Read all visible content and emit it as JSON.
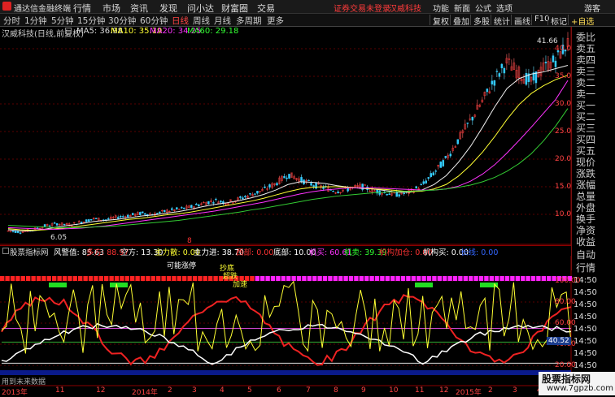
{
  "app": {
    "name": "通达信金融终端"
  },
  "menu": {
    "items": [
      "行情",
      "市场",
      "资讯",
      "发现",
      "问小达",
      "财富圈",
      "交易"
    ],
    "warning": "证券交易未登录",
    "stock": "汉威科技",
    "right_items": [
      "功能",
      "新面",
      "公式",
      "选项"
    ],
    "guest": "游客"
  },
  "toolbar": {
    "periods": [
      "分时",
      "1分钟",
      "5分钟",
      "15分钟",
      "30分钟",
      "60分钟",
      "日线",
      "周线",
      "月线",
      "多周期",
      "更多"
    ],
    "active_period": "日线",
    "right_buttons": [
      "复权",
      "叠加",
      "多股",
      "统计",
      "画线",
      "F10",
      "标记",
      "+自选"
    ]
  },
  "info": {
    "title": "汉威科技(日线,前复权)",
    "ma5": "MA5: 36.98",
    "ma10": "MA10: 35.19",
    "ma20": "MA20: 34.25",
    "ma60": "MA60: 29.18",
    "high_label": "41.66",
    "low_label": "6.05",
    "marker": "8"
  },
  "right_panel": {
    "items": [
      "委比",
      "卖五",
      "卖四",
      "卖三",
      "卖二",
      "卖一",
      "买一",
      "买二",
      "买三",
      "买四",
      "买五",
      "现价",
      "涨跌",
      "涨幅",
      "总量",
      "外盘",
      "换手",
      "净资",
      "收益",
      "自动",
      "行情"
    ]
  },
  "price_axis": {
    "ticks": [
      "40.00",
      "35.00",
      "30.00",
      "25.00",
      "20.00",
      "15.00",
      "10.00"
    ]
  },
  "indicator": {
    "name": "股票指标网",
    "items": [
      {
        "label": "风警值: 85.63",
        "color": "#ffffff"
      },
      {
        "label": "多方: 88.97",
        "color": "#ff3333"
      },
      {
        "label": "空方: 13.30",
        "color": "#ffffff"
      },
      {
        "label": "主力散: 0.00",
        "color": "#ffff33"
      },
      {
        "label": "主力进: 38.70",
        "color": "#ffffff"
      },
      {
        "label": "西部: 0.00",
        "color": "#ff3333"
      },
      {
        "label": "底部: 10.00",
        "color": "#ffffff"
      },
      {
        "label": "机买: 60.61",
        "color": "#ff33ff"
      },
      {
        "label": "机卖: 39.39",
        "color": "#33ff33"
      },
      {
        "label": "机构加仓: 0.00",
        "color": "#ff3333"
      },
      {
        "label": "机构买: 0.00",
        "color": "#ffffff"
      },
      {
        "label": "长线: 0.00",
        "color": "#3366ff"
      }
    ],
    "axis_ticks": [
      "100.00",
      "80.00",
      "60.00",
      "40.00",
      "20.00"
    ],
    "value_badge": "40.52",
    "annotations": [
      "可能涨停",
      "抄底",
      "超跌",
      "加速"
    ],
    "footer_text": "用到未来数据"
  },
  "time_axis": {
    "labels": [
      "2013年",
      "11",
      "12",
      "2014年",
      "2",
      "3",
      "4",
      "5",
      "6",
      "7",
      "8",
      "9",
      "10",
      "11",
      "12",
      "2015年",
      "2",
      "3",
      "4"
    ]
  },
  "right_times": [
    "14:50",
    "14:50",
    "14:50",
    "14:50",
    "14:50",
    "14:50",
    "14:50",
    "14:50"
  ],
  "watermark": {
    "title": "股票指标网",
    "url": "www.7gpzb.com"
  },
  "chart_data": {
    "type": "candlestick",
    "title": "汉威科技(日线,前复权)",
    "ylim": [
      4,
      44
    ],
    "y_ticks": [
      10,
      15,
      20,
      25,
      30,
      35,
      40
    ],
    "series": [
      {
        "name": "close",
        "values": [
          7.0,
          6.8,
          7.2,
          7.9,
          8.3,
          8.1,
          8.6,
          9.2,
          9.0,
          9.5,
          9.8,
          10.2,
          10.0,
          10.6,
          10.9,
          11.3,
          12.0,
          12.5,
          12.1,
          12.8,
          13.6,
          14.4,
          15.6,
          17.2,
          16.3,
          15.4,
          14.8,
          14.2,
          14.6,
          15.1,
          14.3,
          13.9,
          13.6,
          14.0,
          15.2,
          17.5,
          20.0,
          23.5,
          27.0,
          30.5,
          34.5,
          37.5,
          35.5,
          34.0,
          36.5,
          38.0,
          41.0
        ]
      },
      {
        "name": "MA5",
        "values": [
          7.2,
          7.0,
          7.0,
          7.3,
          7.7,
          8.0,
          8.3,
          8.7,
          8.9,
          9.1,
          9.4,
          9.7,
          9.9,
          10.2,
          10.5,
          10.9,
          11.4,
          11.8,
          12.1,
          12.5,
          13.0,
          13.6,
          14.4,
          15.4,
          15.9,
          15.8,
          15.6,
          15.2,
          14.9,
          14.7,
          14.6,
          14.3,
          14.0,
          14.0,
          14.4,
          15.4,
          17.0,
          19.4,
          22.3,
          25.8,
          29.5,
          32.8,
          34.6,
          35.4,
          35.8,
          36.4,
          36.98
        ]
      },
      {
        "name": "MA10",
        "values": [
          7.4,
          7.2,
          7.1,
          7.2,
          7.4,
          7.6,
          7.9,
          8.2,
          8.5,
          8.8,
          9.1,
          9.3,
          9.6,
          9.9,
          10.1,
          10.4,
          10.8,
          11.2,
          11.6,
          12.0,
          12.4,
          12.9,
          13.5,
          14.1,
          14.6,
          14.9,
          15.0,
          15.0,
          14.9,
          14.8,
          14.6,
          14.5,
          14.3,
          14.1,
          14.2,
          14.6,
          15.4,
          16.9,
          18.9,
          21.3,
          24.1,
          27.2,
          29.9,
          31.9,
          33.3,
          34.4,
          35.19
        ]
      },
      {
        "name": "MA20",
        "values": [
          7.6,
          7.5,
          7.4,
          7.3,
          7.3,
          7.4,
          7.5,
          7.7,
          7.9,
          8.2,
          8.5,
          8.8,
          9.1,
          9.4,
          9.7,
          10.0,
          10.3,
          10.6,
          11.0,
          11.4,
          11.8,
          12.2,
          12.7,
          13.2,
          13.7,
          14.1,
          14.4,
          14.6,
          14.8,
          14.8,
          14.8,
          14.7,
          14.6,
          14.5,
          14.4,
          14.4,
          14.6,
          15.1,
          16.0,
          17.3,
          19.0,
          21.1,
          23.4,
          25.8,
          28.3,
          30.8,
          34.25
        ]
      },
      {
        "name": "MA60",
        "values": [
          8.0,
          7.9,
          7.8,
          7.7,
          7.6,
          7.6,
          7.6,
          7.7,
          7.8,
          7.9,
          8.1,
          8.3,
          8.5,
          8.7,
          8.9,
          9.2,
          9.5,
          9.8,
          10.1,
          10.4,
          10.8,
          11.1,
          11.5,
          11.9,
          12.3,
          12.7,
          13.0,
          13.3,
          13.5,
          13.7,
          13.9,
          14.0,
          14.1,
          14.2,
          14.3,
          14.4,
          14.6,
          14.9,
          15.3,
          15.9,
          16.7,
          17.8,
          19.2,
          21.0,
          23.3,
          26.0,
          29.18
        ]
      }
    ],
    "high": 41.66,
    "low": 6.05
  }
}
